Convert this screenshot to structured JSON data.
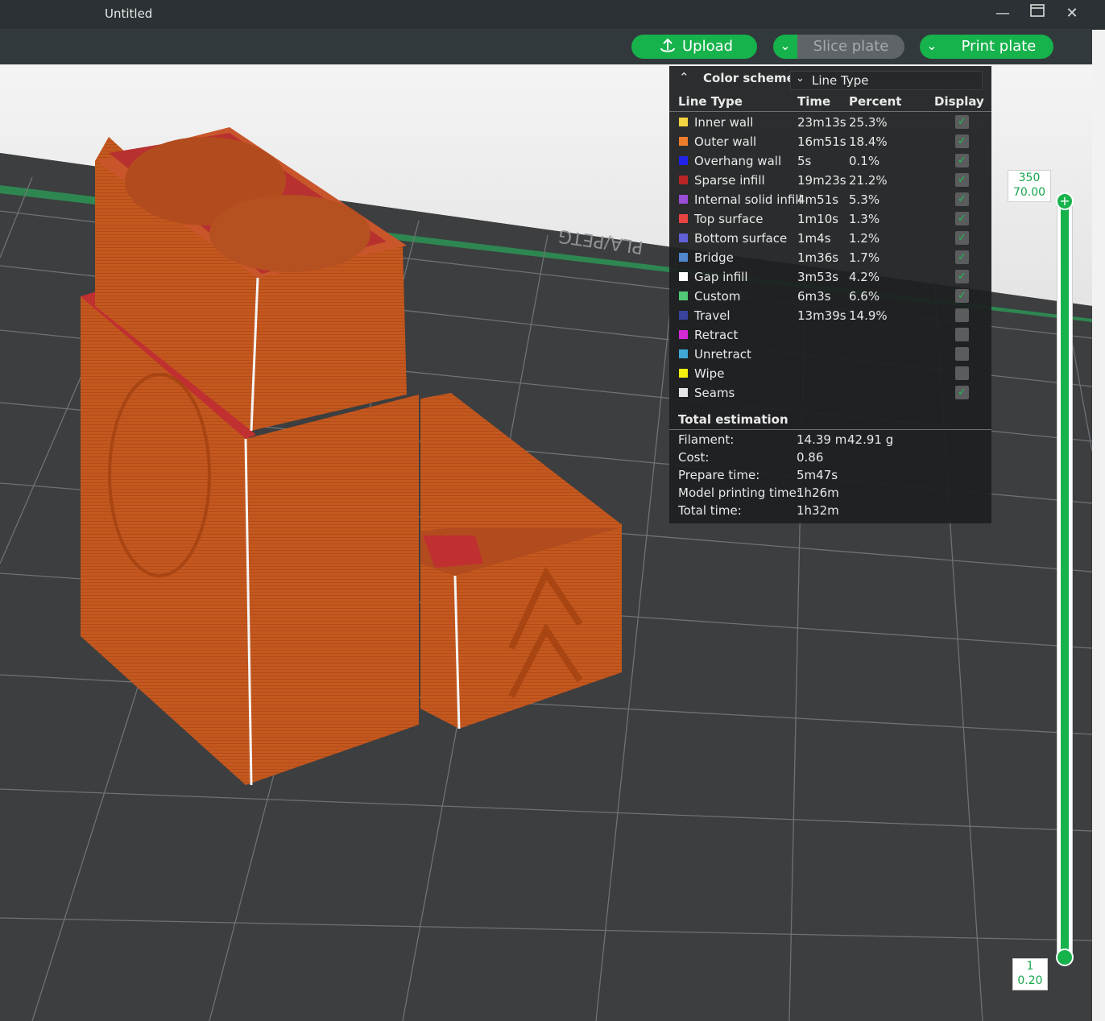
{
  "window": {
    "title": "Untitled"
  },
  "toolbar": {
    "upload_label": "Upload",
    "slice_label": "Slice plate",
    "print_label": "Print plate"
  },
  "icons": {
    "upload": "upload-icon",
    "minimize": "minimize-icon",
    "maximize": "maximize-icon",
    "close": "close-icon"
  },
  "colors": {
    "accent": "#16b24b",
    "model": "#c4581f"
  },
  "legend": {
    "scheme_label": "Color scheme",
    "scheme_value": "Line Type",
    "columns": [
      "Line Type",
      "Time",
      "Percent",
      "Display"
    ],
    "rows": [
      {
        "name": "Inner wall",
        "time": "23m13s",
        "percent": "25.3%",
        "color": "#f5d442",
        "checked": true
      },
      {
        "name": "Outer wall",
        "time": "16m51s",
        "percent": "18.4%",
        "color": "#ee7d2b",
        "checked": true
      },
      {
        "name": "Overhang wall",
        "time": "5s",
        "percent": "0.1%",
        "color": "#2222e8",
        "checked": true
      },
      {
        "name": "Sparse infill",
        "time": "19m23s",
        "percent": "21.2%",
        "color": "#b82424",
        "checked": true
      },
      {
        "name": "Internal solid infill",
        "time": "4m51s",
        "percent": "5.3%",
        "color": "#9a4dd6",
        "checked": true
      },
      {
        "name": "Top surface",
        "time": "1m10s",
        "percent": "1.3%",
        "color": "#e84343",
        "checked": true
      },
      {
        "name": "Bottom surface",
        "time": "1m4s",
        "percent": "1.2%",
        "color": "#6060d8",
        "checked": true
      },
      {
        "name": "Bridge",
        "time": "1m36s",
        "percent": "1.7%",
        "color": "#4f86cc",
        "checked": true
      },
      {
        "name": "Gap infill",
        "time": "3m53s",
        "percent": "4.2%",
        "color": "#ffffff",
        "checked": true
      },
      {
        "name": "Custom",
        "time": "6m3s",
        "percent": "6.6%",
        "color": "#52c977",
        "checked": true
      },
      {
        "name": "Travel",
        "time": "13m39s",
        "percent": "14.9%",
        "color": "#38449e",
        "checked": false
      },
      {
        "name": "Retract",
        "time": "",
        "percent": "",
        "color": "#d42ad4",
        "checked": false
      },
      {
        "name": "Unretract",
        "time": "",
        "percent": "",
        "color": "#3fa9d8",
        "checked": false
      },
      {
        "name": "Wipe",
        "time": "",
        "percent": "",
        "color": "#f5f010",
        "checked": false
      },
      {
        "name": "Seams",
        "time": "",
        "percent": "",
        "color": "#e6e6e6",
        "checked": true
      }
    ],
    "estimation_title": "Total estimation",
    "estimation": [
      {
        "label": "Filament:",
        "value": "14.39 m",
        "value2": "42.91 g"
      },
      {
        "label": "Cost:",
        "value": "0.86",
        "value2": ""
      },
      {
        "label": "Prepare time:",
        "value": "5m47s",
        "value2": ""
      },
      {
        "label": "Model printing time:",
        "value": "1h26m",
        "value2": ""
      },
      {
        "label": "Total time:",
        "value": "1h32m",
        "value2": ""
      }
    ]
  },
  "layer_slider": {
    "top_layer": "350",
    "top_height": "70.00",
    "bottom_layer": "1",
    "bottom_height": "0.20"
  },
  "plate": {
    "label": "PLA/PETG"
  }
}
